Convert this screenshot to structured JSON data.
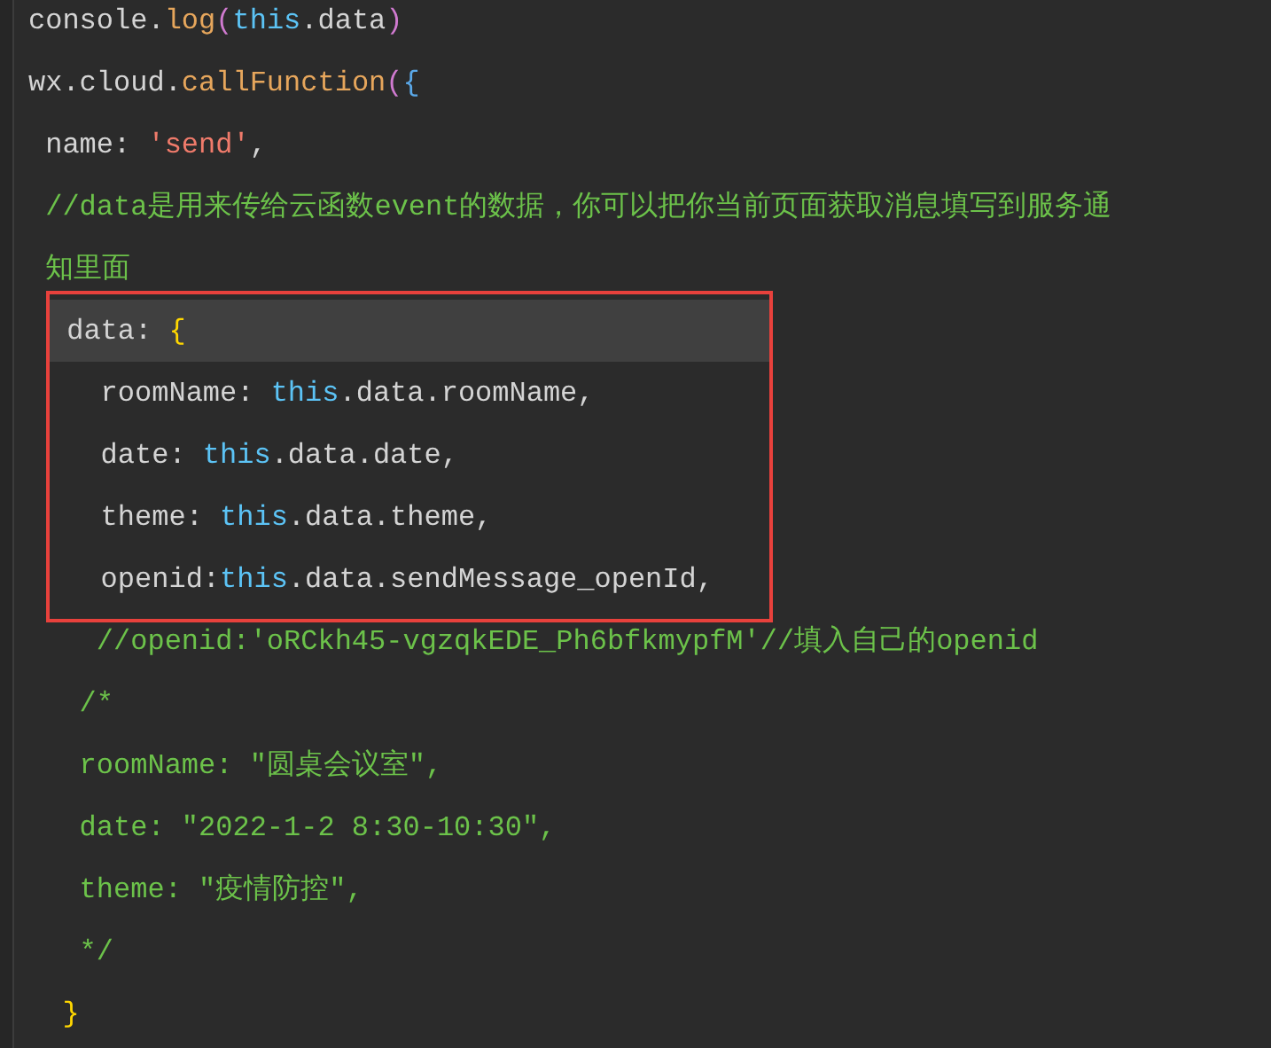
{
  "editor": {
    "blocks": [
      {
        "boxed": false,
        "lines": [
          {
            "current": false,
            "tokens": [
              {
                "kind": "plain",
                "text": "console."
              },
              {
                "kind": "function",
                "text": "log"
              },
              {
                "kind": "paren",
                "text": "("
              },
              {
                "kind": "keyword",
                "text": "this"
              },
              {
                "kind": "plain",
                "text": ".data"
              },
              {
                "kind": "paren",
                "text": ")"
              }
            ]
          },
          {
            "current": false,
            "tokens": [
              {
                "kind": "plain",
                "text": "wx.cloud."
              },
              {
                "kind": "function",
                "text": "callFunction"
              },
              {
                "kind": "paren",
                "text": "("
              },
              {
                "kind": "brace",
                "text": "{"
              }
            ]
          },
          {
            "current": false,
            "tokens": [
              {
                "kind": "plain",
                "text": " name: "
              },
              {
                "kind": "string",
                "text": "'send'"
              },
              {
                "kind": "plain",
                "text": ","
              }
            ]
          },
          {
            "current": false,
            "tokens": [
              {
                "kind": "comment",
                "text": " //data是用来传给云函数event的数据，你可以把你当前页面获取消息填写到服务通"
              }
            ]
          },
          {
            "current": false,
            "tokens": [
              {
                "kind": "comment",
                "text": " 知里面"
              }
            ]
          }
        ]
      },
      {
        "boxed": true,
        "lines": [
          {
            "current": true,
            "tokens": [
              {
                "kind": "plain",
                "text": " data: "
              },
              {
                "kind": "match",
                "text": "{"
              }
            ]
          },
          {
            "current": false,
            "tokens": [
              {
                "kind": "plain",
                "text": "   roomName: "
              },
              {
                "kind": "keyword",
                "text": "this"
              },
              {
                "kind": "plain",
                "text": ".data.roomName,"
              }
            ]
          },
          {
            "current": false,
            "tokens": [
              {
                "kind": "plain",
                "text": "   date: "
              },
              {
                "kind": "keyword",
                "text": "this"
              },
              {
                "kind": "plain",
                "text": ".data.date,"
              }
            ]
          },
          {
            "current": false,
            "tokens": [
              {
                "kind": "plain",
                "text": "   theme: "
              },
              {
                "kind": "keyword",
                "text": "this"
              },
              {
                "kind": "plain",
                "text": ".data.theme,"
              }
            ]
          },
          {
            "current": false,
            "tokens": [
              {
                "kind": "plain",
                "text": "   openid:"
              },
              {
                "kind": "keyword",
                "text": "this"
              },
              {
                "kind": "plain",
                "text": ".data.sendMessage_openId,"
              }
            ]
          }
        ]
      },
      {
        "boxed": false,
        "lines": [
          {
            "current": false,
            "tokens": [
              {
                "kind": "comment",
                "text": "    //openid:'oRCkh45-vgzqkEDE_Ph6bfkmypfM'//填入自己的openid"
              }
            ]
          },
          {
            "current": false,
            "tokens": [
              {
                "kind": "comment",
                "text": "   /*"
              }
            ]
          },
          {
            "current": false,
            "tokens": [
              {
                "kind": "comment",
                "text": "   roomName: \"圆桌会议室\","
              }
            ]
          },
          {
            "current": false,
            "tokens": [
              {
                "kind": "comment",
                "text": "   date: \"2022-1-2 8:30-10:30\","
              }
            ]
          },
          {
            "current": false,
            "tokens": [
              {
                "kind": "comment",
                "text": "   theme: \"疫情防控\","
              }
            ]
          },
          {
            "current": false,
            "tokens": [
              {
                "kind": "comment",
                "text": "   */"
              }
            ]
          },
          {
            "current": false,
            "tokens": [
              {
                "kind": "match",
                "text": "  }"
              }
            ]
          }
        ]
      }
    ]
  }
}
